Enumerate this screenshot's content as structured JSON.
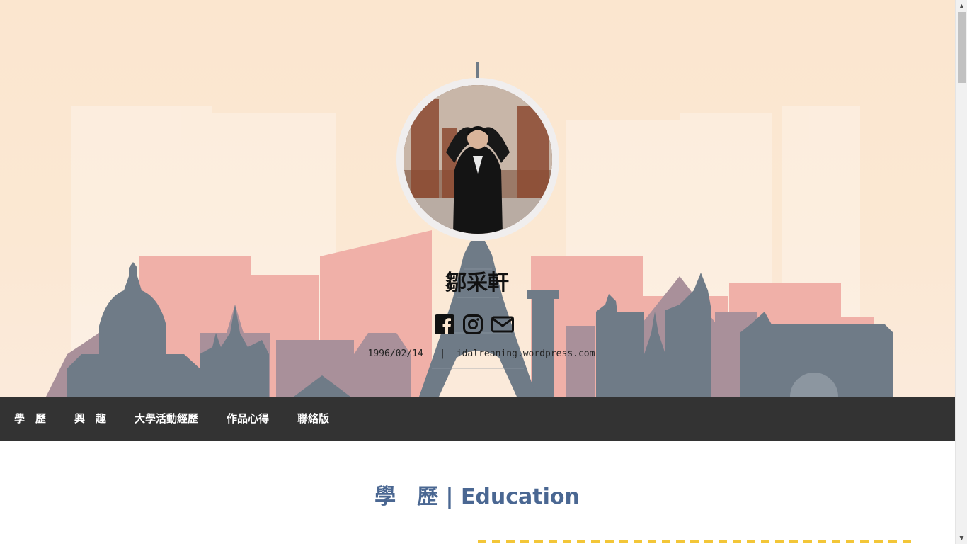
{
  "profile": {
    "name": "鄒采軒",
    "birthday": "1996/02/14",
    "separator": "|",
    "website": "idalreaning.wordpress.com"
  },
  "social": [
    {
      "icon": "facebook-icon"
    },
    {
      "icon": "instagram-icon"
    },
    {
      "icon": "mail-icon"
    }
  ],
  "nav": {
    "items": [
      {
        "label": "學　歷"
      },
      {
        "label": "興　趣"
      },
      {
        "label": "大學活動經歷"
      },
      {
        "label": "作品心得"
      },
      {
        "label": "聯絡版"
      }
    ]
  },
  "section": {
    "title": "學　歷 | Education"
  },
  "colors": {
    "hero_bg": "#fbe6cf",
    "skyline_pink": "#f0b0a8",
    "skyline_slate": "#6f7b87",
    "skyline_mauve": "#a9909a",
    "nav_bg": "#333333",
    "title_blue": "#4a6792",
    "dash_yellow": "#f3c638"
  }
}
